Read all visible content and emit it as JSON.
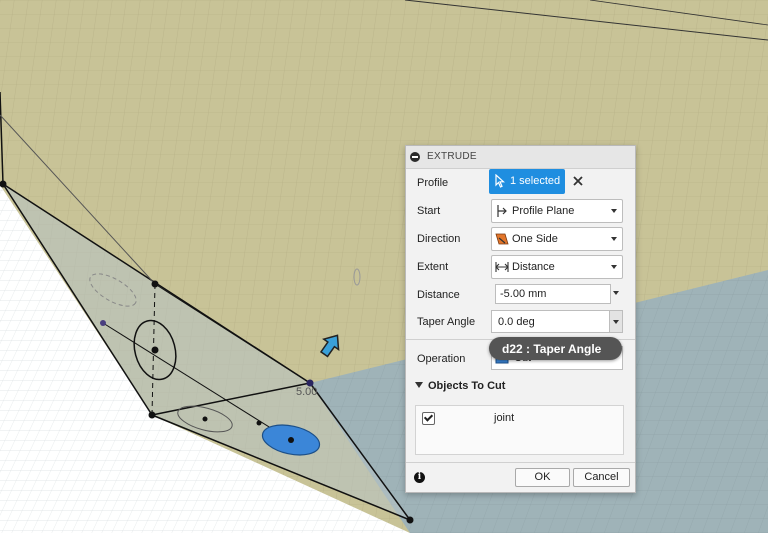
{
  "panel": {
    "title": "EXTRUDE",
    "profile_label": "Profile",
    "profile_value": "1 selected",
    "start_label": "Start",
    "start_value": "Profile Plane",
    "direction_label": "Direction",
    "direction_value": "One Side",
    "extent_label": "Extent",
    "extent_value": "Distance",
    "distance_label": "Distance",
    "distance_value": "-5.00 mm",
    "taper_label": "Taper Angle",
    "taper_value": "0.0 deg",
    "operation_label": "Operation",
    "operation_value": "Cut",
    "objects_heading": "Objects To Cut",
    "objects": [
      {
        "name": "joint",
        "checked": true
      }
    ],
    "ok_label": "OK",
    "cancel_label": "Cancel"
  },
  "tooltip": {
    "text": "d22 : Taper Angle"
  },
  "viewport": {
    "dimension_label": "5.00"
  },
  "colors": {
    "accent": "#1f8ee0",
    "face_tan": "#c8c397",
    "face_blue": "#9fb3b8",
    "profile_blue": "#3b86d8"
  },
  "icons": [
    "collapse-icon",
    "cursor-icon",
    "close-icon",
    "profile-plane-icon",
    "one-side-icon",
    "distance-icon",
    "cut-icon",
    "triangle-down-icon",
    "checkbox-icon",
    "info-icon",
    "arrow-manipulator-icon"
  ]
}
